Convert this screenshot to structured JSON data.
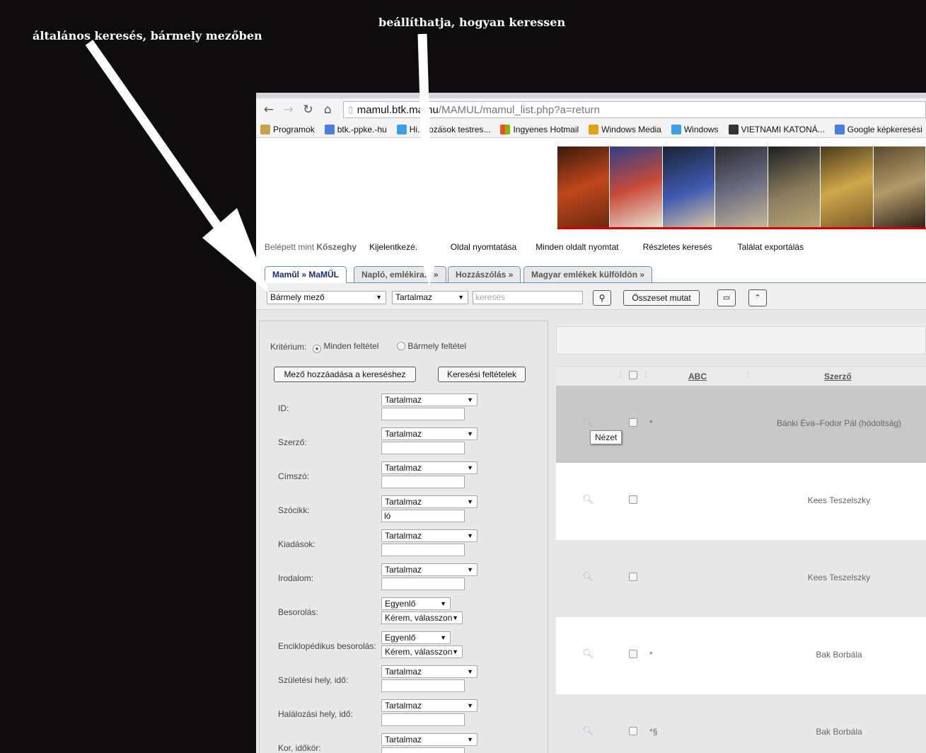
{
  "annotations": {
    "general_search": "általános keresés, bármely mezőben",
    "search_mode": "beállíthatja, hogyan keressen"
  },
  "browser": {
    "url_host": "mamul.btk.m",
    "url_hidden": "a.hu",
    "url_path": "/MAMUL/mamul_list.php?a=return",
    "bookmarks": [
      "Programok",
      "btk.-ppke.-hu",
      "Hi...kozások testres...",
      "Ingyenes Hotmail",
      "Windows Media",
      "Windows",
      "VIETNAMI KATONÁ...",
      "Google képkeresési"
    ]
  },
  "menu": {
    "logged_in_prefix": "Belépett mint",
    "user": "Kőszeghy",
    "logout": "Kijelentkezé...",
    "print_page": "Oldal nyomtatása",
    "print_all": "Minden oldalt nyomtat",
    "advanced_search": "Részletes keresés",
    "export": "Találat exportálás"
  },
  "tabs": [
    "Mamŭl » MaMŰL",
    "Napló, emlékira... »",
    "Hozzászólás »",
    "Magyar emlékek külföldön »"
  ],
  "toolbar": {
    "field_select": "Bármely mező",
    "mode_select": "Tartalmaz",
    "search_placeholder": "keresés",
    "show_all": "Összeset mutat"
  },
  "criteria": {
    "label": "Kritérium:",
    "all": "Minden feltétel",
    "any": "Bármely feltétel",
    "add_field": "Mező hozzáadása a kereséshez",
    "search_conditions": "Keresési feltételek"
  },
  "fields": [
    {
      "label": "ID:",
      "mode": "Tartalmaz",
      "value": ""
    },
    {
      "label": "Szerző:",
      "mode": "Tartalmaz",
      "value": ""
    },
    {
      "label": "Címszó:",
      "mode": "Tartalmaz",
      "value": ""
    },
    {
      "label": "Szócikk:",
      "mode": "Tartalmaz",
      "value": "ló"
    },
    {
      "label": "Kiadások:",
      "mode": "Tartalmaz",
      "value": ""
    },
    {
      "label": "Irodalom:",
      "mode": "Tartalmaz",
      "value": ""
    },
    {
      "label": "Besorolás:",
      "mode": "Egyenlő",
      "value": "Kérem, válasszon"
    },
    {
      "label": "Enciklopédikus besorolás:",
      "mode": "Egyenlő",
      "value": "Kérem, válasszon"
    },
    {
      "label": "Születési hely, idő:",
      "mode": "Tartalmaz",
      "value": ""
    },
    {
      "label": "Halálozási hely, idő:",
      "mode": "Tartalmaz",
      "value": ""
    },
    {
      "label": "Kor, időkör:",
      "mode": "Tartalmaz",
      "value": ""
    }
  ],
  "table": {
    "col_abc": "ABC",
    "col_author": "Szerző",
    "tooltip": "Nézet",
    "rows": [
      {
        "abc": "*",
        "author": "Bánki Éva–Fodor Pál (hódoltság)",
        "bg": "#c8c8c8"
      },
      {
        "abc": "",
        "author": "Kees Teszelszky",
        "bg": "#ffffff"
      },
      {
        "abc": "",
        "author": "Kees Teszelszky",
        "bg": "#e8e8e8"
      },
      {
        "abc": "*",
        "author": "Bak Borbála",
        "bg": "#ffffff"
      },
      {
        "abc": "*§",
        "author": "Bak Borbála",
        "bg": "#e8e8e8"
      }
    ]
  },
  "colors": {
    "tab_border": "#6a8bbf",
    "tab_active_text": "#1c2c7a",
    "banner_rule": "#d40000"
  }
}
